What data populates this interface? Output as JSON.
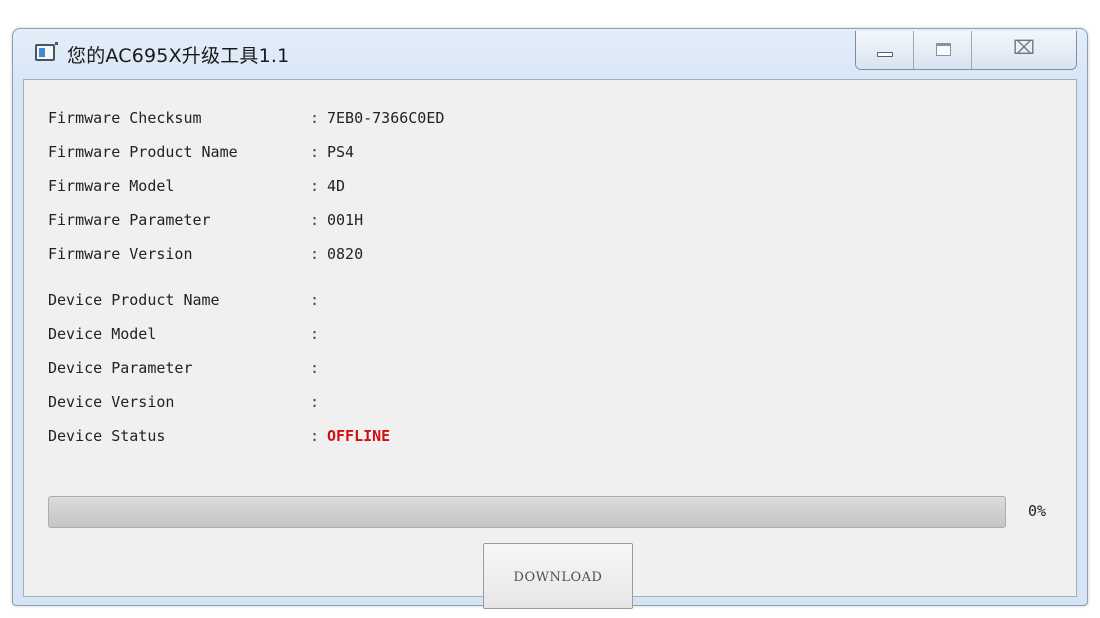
{
  "window": {
    "title": "您的AC695X升级工具1.1",
    "close_glyph": "⌧"
  },
  "firmware": [
    {
      "label": "Firmware Checksum",
      "value": "7EB0-7366C0ED"
    },
    {
      "label": "Firmware Product Name",
      "value": "PS4"
    },
    {
      "label": "Firmware Model",
      "value": "4D"
    },
    {
      "label": "Firmware Parameter",
      "value": "001H"
    },
    {
      "label": "Firmware Version",
      "value": "0820"
    }
  ],
  "device": [
    {
      "label": "Device Product Name",
      "value": ""
    },
    {
      "label": "Device Model",
      "value": ""
    },
    {
      "label": "Device Parameter",
      "value": ""
    },
    {
      "label": "Device Version",
      "value": ""
    },
    {
      "label": "Device Status",
      "value": "OFFLINE"
    }
  ],
  "separator": ":",
  "progress": {
    "percent_text": "0%",
    "value": 0
  },
  "download_button": "DOWNLOAD",
  "colors": {
    "status_offline": "#d10f0f",
    "window_frame": "#d7e4f3",
    "client_bg": "#f0f0f0"
  }
}
